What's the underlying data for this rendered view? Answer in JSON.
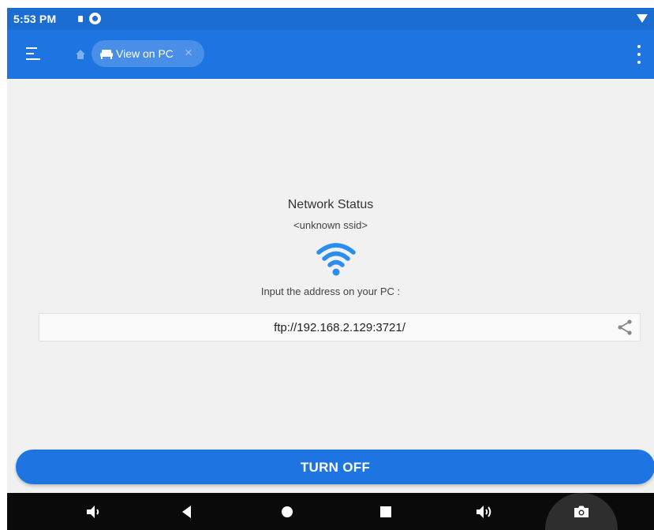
{
  "status_bar": {
    "time": "5:53 PM"
  },
  "app_bar": {
    "tab_label": "View on PC",
    "tab_close": "×"
  },
  "content": {
    "heading": "Network Status",
    "ssid": "<unknown ssid>",
    "instruction": "Input the address on your PC :",
    "address": "ftp://192.168.2.129:3721/",
    "turn_off_label": "TURN OFF"
  },
  "colors": {
    "status_bar": "#1b6dd1",
    "app_bar": "#1e74e0",
    "tab_chip": "#4a8fe7",
    "wifi_icon": "#2a8ef0",
    "content_bg": "#f1f1f1",
    "nav_bar": "#0a0a0a"
  },
  "icons": [
    "menu-icon",
    "home-icon",
    "sofa-icon",
    "close-icon",
    "more-vert-icon",
    "wifi-icon",
    "share-icon",
    "volume-down-icon",
    "back-icon",
    "home-circle-icon",
    "recents-icon",
    "volume-up-icon",
    "camera-icon"
  ]
}
